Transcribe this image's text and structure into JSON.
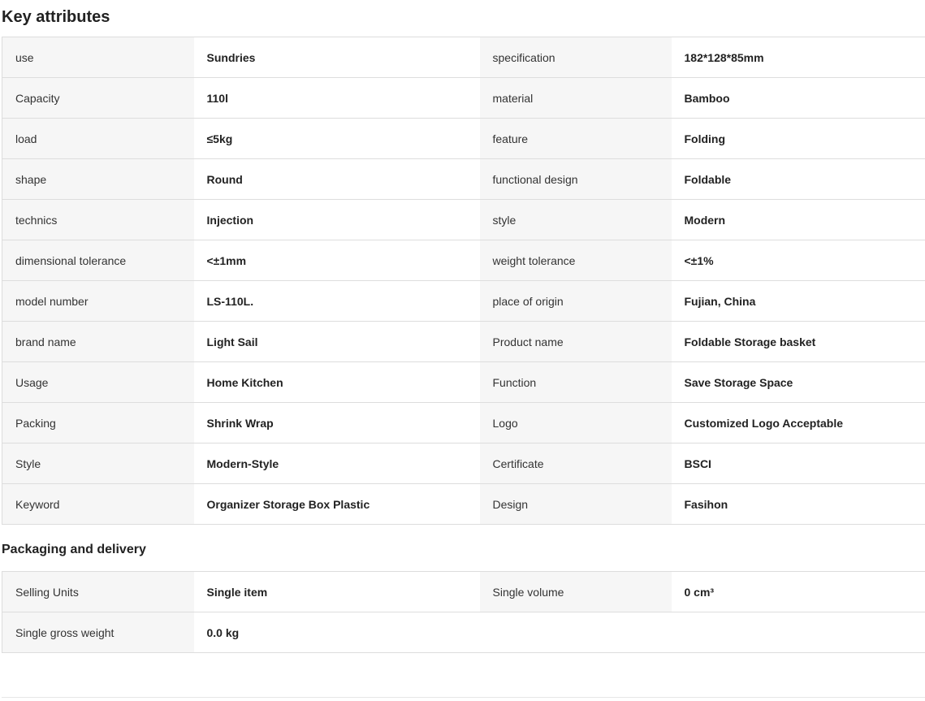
{
  "key_attributes": {
    "title": "Key attributes",
    "rows": [
      [
        {
          "k": "use",
          "v": "Sundries"
        },
        {
          "k": "specification",
          "v": "182*128*85mm"
        }
      ],
      [
        {
          "k": "Capacity",
          "v": "110l"
        },
        {
          "k": "material",
          "v": "Bamboo"
        }
      ],
      [
        {
          "k": "load",
          "v": "≤5kg"
        },
        {
          "k": "feature",
          "v": "Folding"
        }
      ],
      [
        {
          "k": "shape",
          "v": "Round"
        },
        {
          "k": "functional design",
          "v": "Foldable"
        }
      ],
      [
        {
          "k": "technics",
          "v": "Injection"
        },
        {
          "k": "style",
          "v": "Modern"
        }
      ],
      [
        {
          "k": "dimensional tolerance",
          "v": "<±1mm"
        },
        {
          "k": "weight tolerance",
          "v": "<±1%"
        }
      ],
      [
        {
          "k": "model number",
          "v": "LS-110L."
        },
        {
          "k": "place of origin",
          "v": "Fujian, China"
        }
      ],
      [
        {
          "k": "brand name",
          "v": "Light Sail"
        },
        {
          "k": "Product name",
          "v": "Foldable Storage basket"
        }
      ],
      [
        {
          "k": "Usage",
          "v": "Home Kitchen"
        },
        {
          "k": "Function",
          "v": "Save Storage Space"
        }
      ],
      [
        {
          "k": "Packing",
          "v": "Shrink Wrap"
        },
        {
          "k": "Logo",
          "v": "Customized Logo Acceptable"
        }
      ],
      [
        {
          "k": "Style",
          "v": "Modern-Style"
        },
        {
          "k": "Certificate",
          "v": "BSCI"
        }
      ],
      [
        {
          "k": "Keyword",
          "v": "Organizer Storage Box Plastic"
        },
        {
          "k": "Design",
          "v": "Fasihon"
        }
      ]
    ]
  },
  "packaging": {
    "title": "Packaging and delivery",
    "rows": [
      [
        {
          "k": "Selling Units",
          "v": "Single item"
        },
        {
          "k": "Single volume",
          "v": "0 cm³"
        }
      ],
      [
        {
          "k": "Single gross weight",
          "v": "0.0 kg"
        }
      ]
    ]
  }
}
